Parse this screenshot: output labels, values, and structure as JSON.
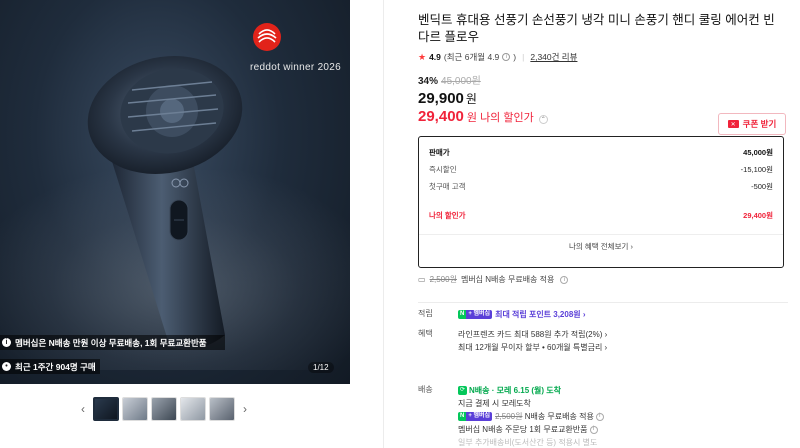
{
  "gallery": {
    "award_text": "reddot winner 2026",
    "promo_line1": "멤버십은 N배송 만원 이상 무료배송, 1회 무료교환반품",
    "promo_line2": "최근 1주간 904명 구매",
    "page_counter": "1/12",
    "thumb_count": 5,
    "prev_arrow": "‹",
    "next_arrow": "›"
  },
  "product": {
    "title": "벤딕트 휴대용 선풍기 손선풍기 냉각 미니 손풍기 핸디 쿨링 에어컨 빈다르 플로우",
    "rating": "4.9",
    "rating_detail": "(최근 6개월 4.9",
    "rating_detail_close": ")",
    "review_count": "2,340건 리뷰",
    "discount_pct": "34%",
    "original_price": "45,000원",
    "sale_price": "29,900",
    "won": "원",
    "my_price": "29,400",
    "my_price_label": "원 나의 할인가",
    "coupon_label": "쿠폰 받기"
  },
  "breakdown": {
    "rows": [
      {
        "k": "판매가",
        "v": "45,000원"
      },
      {
        "k": "즉시할인",
        "v": "-15,100원"
      },
      {
        "k": "첫구매 고객",
        "v": "-500원"
      }
    ],
    "mine_label": "나의 할인가",
    "mine_value": "29,400원",
    "all_benefits": "나의 혜택 전체보기 ›"
  },
  "shipping_line": {
    "orig_fee": "2,500원",
    "text": "멤버십 N배송 무료배송 적용"
  },
  "sections": {
    "points_label": "적립",
    "points_text": "최대 적립 포인트 3,208원 ›",
    "benefit_label": "혜택",
    "benefit_line1": "라인프렌즈 카드 최대 588원 추가 적립(2%) ›",
    "benefit_line2": "최대 12개월 무이자 할부 • 60개월 특별금리 ›",
    "delivery_label": "배송",
    "delivery_arrive": "N배송 · 모레 6.15 (월) 도착",
    "delivery_line2": "지금 결제 시 모레도착",
    "delivery_fee_orig": "2,500원",
    "delivery_fee_text": "N배송 무료배송 적용",
    "delivery_line4": "멤버십 N배송 주문당 1회 무료교환반품",
    "delivery_line5": "일부 추가배송비(도서산간 등) 적용시 별도"
  },
  "badge": {
    "n_text": "N",
    "plus_text": "+ 멤버십"
  },
  "colors": {
    "accent_red": "#f0233a",
    "naver_green": "#03c75a",
    "membership_purple": "#5a3fd8"
  }
}
